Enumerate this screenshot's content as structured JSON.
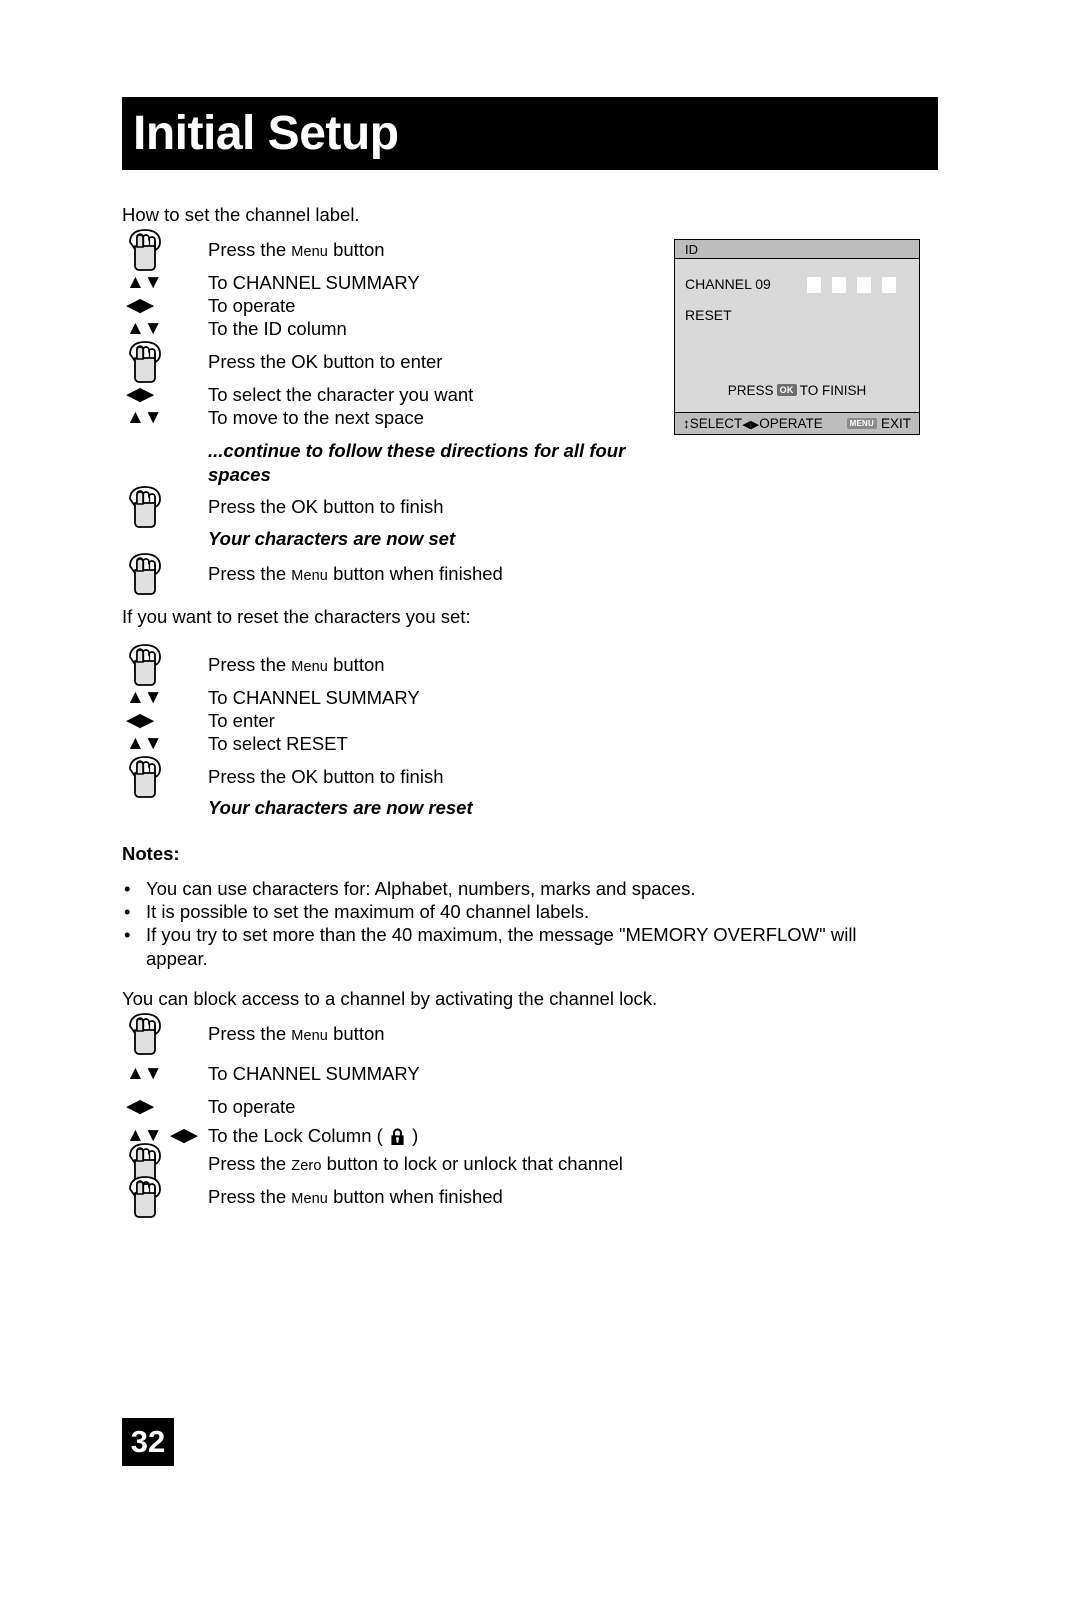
{
  "header": {
    "title": "Initial Setup"
  },
  "page_number": "32",
  "sections": {
    "label_intro": "How to set the channel label.",
    "reset_intro": "If you want to reset the characters you set:",
    "lock_intro": "You can block access to a channel by activating the channel lock."
  },
  "steps_label": [
    {
      "icon": "hand-press-icon",
      "text_pre": "Press the ",
      "smallcap": "Menu",
      "text_post": " button"
    },
    {
      "icon": "up-down-arrows-icon",
      "text_pre": "To CHANNEL SUMMARY",
      "smallcap": "",
      "text_post": ""
    },
    {
      "icon": "left-right-arrows-icon",
      "text_pre": "To operate",
      "smallcap": "",
      "text_post": ""
    },
    {
      "icon": "up-down-arrows-icon",
      "text_pre": "To the ID column",
      "smallcap": "",
      "text_post": ""
    },
    {
      "icon": "hand-press-icon",
      "text_pre": "Press the OK button to enter",
      "smallcap": "",
      "text_post": ""
    },
    {
      "icon": "left-right-arrows-icon",
      "text_pre": "To select the character you want",
      "smallcap": "",
      "text_post": ""
    },
    {
      "icon": "up-down-arrows-icon",
      "text_pre": "To move to the next space",
      "smallcap": "",
      "text_post": ""
    }
  ],
  "italic_continue": "...continue to follow these directions for all four spaces",
  "steps_label_end": [
    {
      "icon": "hand-press-icon",
      "text_pre": "Press the OK button to finish",
      "smallcap": "",
      "text_post": ""
    }
  ],
  "italic_set": "Your characters are now set",
  "steps_label_final": [
    {
      "icon": "hand-press-icon",
      "text_pre": "Press the ",
      "smallcap": "Menu",
      "text_post": " button when finished"
    }
  ],
  "steps_reset": [
    {
      "icon": "hand-press-icon",
      "text_pre": "Press the ",
      "smallcap": "Menu",
      "text_post": " button"
    },
    {
      "icon": "up-down-arrows-icon",
      "text_pre": "To CHANNEL SUMMARY",
      "smallcap": "",
      "text_post": ""
    },
    {
      "icon": "left-right-arrows-icon",
      "text_pre": "To enter",
      "smallcap": "",
      "text_post": ""
    },
    {
      "icon": "up-down-arrows-icon",
      "text_pre": "To select RESET",
      "smallcap": "",
      "text_post": ""
    },
    {
      "icon": "hand-press-icon",
      "text_pre": "Press the OK button to finish",
      "smallcap": "",
      "text_post": ""
    }
  ],
  "italic_reset": "Your characters are now reset",
  "notes": {
    "heading": "Notes:",
    "bullet_char": "•",
    "items": [
      "You can use characters for: Alphabet, numbers, marks and spaces.",
      "It is possible to set the maximum of 40 channel labels.",
      "If you try to set more than the 40 maximum, the message \"MEMORY OVERFLOW\" will appear."
    ]
  },
  "steps_lock": [
    {
      "icon": "hand-press-icon",
      "text_pre": "Press the ",
      "smallcap": "Menu",
      "text_post": " button"
    },
    {
      "icon": "up-down-arrows-icon",
      "text_pre": "To CHANNEL SUMMARY",
      "smallcap": "",
      "text_post": ""
    },
    {
      "icon": "left-right-arrows-icon",
      "text_pre": "To operate",
      "smallcap": "",
      "text_post": ""
    }
  ],
  "lock_column": {
    "icon": "up-down-left-right-arrows-icon",
    "text_before": "To the Lock Column ( ",
    "text_after": " )"
  },
  "steps_lock_end": [
    {
      "icon": "hand-press-icon",
      "text_pre": "Press the ",
      "smallcap": "Zero",
      "text_post": " button to lock or unlock that channel"
    },
    {
      "icon": "hand-press-icon",
      "text_pre": "Press the ",
      "smallcap": "Menu",
      "text_post": " button when finished"
    }
  ],
  "osd": {
    "title": "ID",
    "channel_label": "CHANNEL 09",
    "reset_label": "RESET",
    "char_slots": 4,
    "press_text_before": "PRESS",
    "press_chip": "OK",
    "press_text_after": "TO FINISH",
    "footer_select": "SELECT",
    "footer_operate": "OPERATE",
    "footer_menu_chip": "MENU",
    "footer_exit": "EXIT",
    "colors": {
      "panel_bg": "#d9d9d9",
      "title_bg": "#bdbdbd",
      "footer_bg": "#bdbdbd",
      "slot_fill": "#ffffff",
      "chip_bg": "#6e6e6e"
    }
  },
  "arrow_glyphs": {
    "up": "▲",
    "down": "▼",
    "left": "◀",
    "right": "▶",
    "updown_pair": "▲▼",
    "leftright_pair": "◀▶",
    "vertical_double": "↕"
  }
}
